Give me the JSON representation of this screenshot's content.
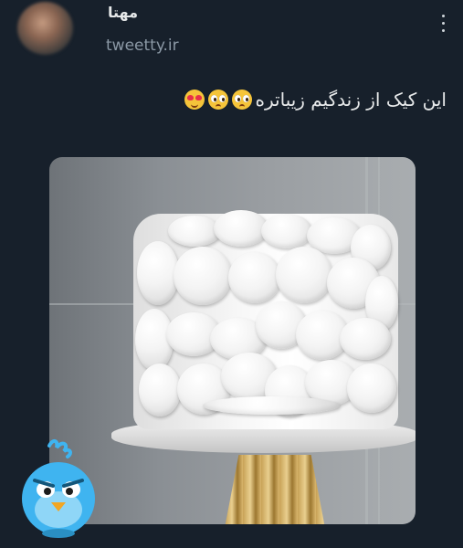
{
  "author": {
    "name": "مهتا",
    "handle": "tweetty.ir"
  },
  "tweet": {
    "text": "این کیک از زندگیم زیباتره",
    "emojis": [
      "pleading-face-emoji",
      "pleading-face-emoji",
      "heart-eyes-emoji"
    ]
  },
  "colors": {
    "background": "#17202b",
    "text": "#e7e9ea",
    "secondary_text": "#8b98a5",
    "mascot": "#3fb4f0"
  },
  "icons": {
    "menu": "more-vertical-icon",
    "watermark": "tweetty-bird-mascot-icon"
  }
}
